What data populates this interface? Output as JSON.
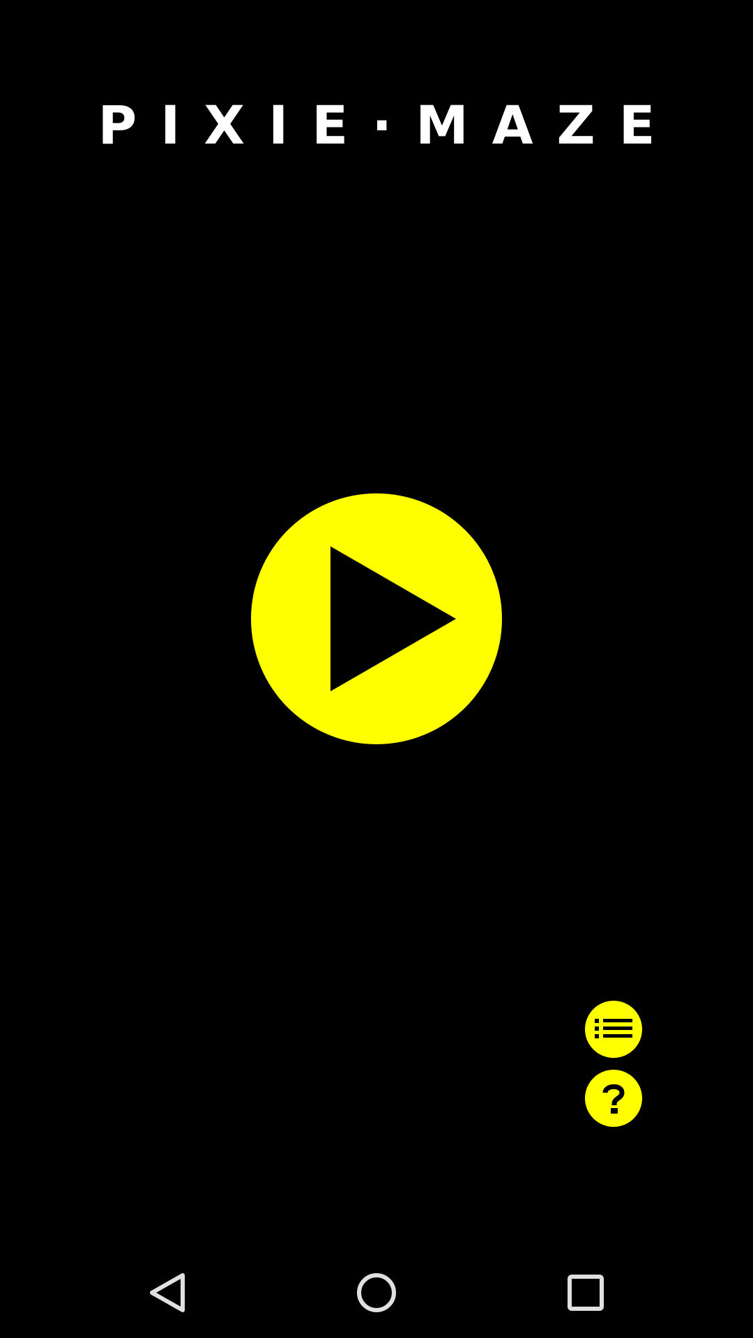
{
  "app": {
    "title": "PIXIE·MAZE"
  },
  "colors": {
    "background": "#000000",
    "accent": "#ffff00",
    "title": "#ffffff",
    "nav_icons": "#e0e0e0"
  },
  "main": {
    "play_icon": "play-icon"
  },
  "side_actions": [
    {
      "icon": "list-icon"
    },
    {
      "icon": "help-icon"
    }
  ],
  "nav_bar": {
    "back_icon": "back-triangle-icon",
    "home_icon": "home-circle-icon",
    "recents_icon": "recents-square-icon"
  }
}
